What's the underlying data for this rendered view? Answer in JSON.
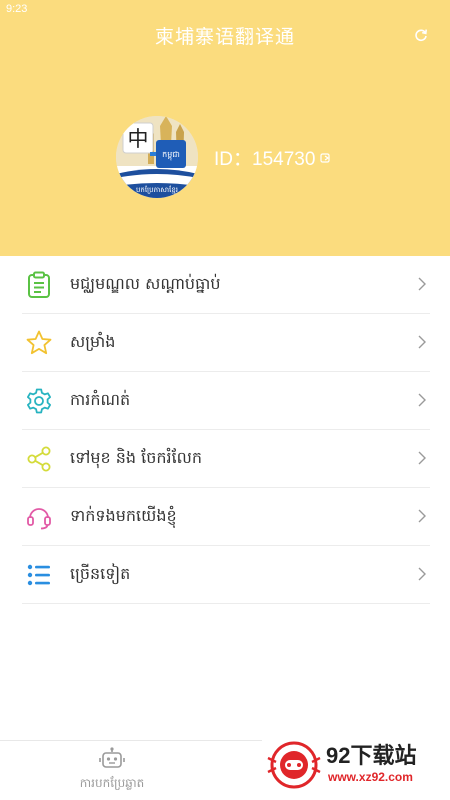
{
  "status_bar": {
    "time": "9:23"
  },
  "header": {
    "title": "柬埔寨语翻译通",
    "refresh_icon": "refresh-icon",
    "user_id": "ID：154730",
    "avatar_char": "中",
    "avatar_badge": "កម្ពុជា",
    "avatar_caption": "បកប្រែភាសាខ្មែរ",
    "background_color": "#fbdc7e"
  },
  "menu": [
    {
      "label": "មជ្ឈមណ្ឌល សណ្តាប់ធ្នាប់",
      "icon": "clipboard-icon",
      "color": "#5ac244"
    },
    {
      "label": "សម្រាំង",
      "icon": "star-icon",
      "color": "#f2c230"
    },
    {
      "label": "ការកំណត់",
      "icon": "gear-icon",
      "color": "#27b3c0"
    },
    {
      "label": "ទៅមុខ និង ចែករំលែក",
      "icon": "share-icon",
      "color": "#d4db3a"
    },
    {
      "label": "ទាក់ទងមកយើងខ្ញុំ",
      "icon": "headset-icon",
      "color": "#e25aa6"
    },
    {
      "label": "ច្រើនទៀត",
      "icon": "list-icon",
      "color": "#2a8ee0"
    }
  ],
  "bottom_nav": {
    "translate_label": "ការបកប្រែឆ្លាត",
    "translate_icon": "robot-icon"
  },
  "watermark": {
    "text": "92下载站",
    "url": "www.xz92.com"
  }
}
